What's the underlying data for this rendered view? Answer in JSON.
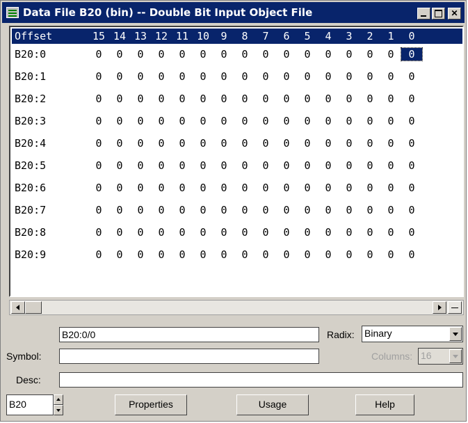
{
  "window": {
    "title": "Data File B20 (bin) -- Double Bit Input Object File"
  },
  "grid": {
    "offset_header": "Offset",
    "bit_headers": [
      "15",
      "14",
      "13",
      "12",
      "11",
      "10",
      "9",
      "8",
      "7",
      "6",
      "5",
      "4",
      "3",
      "2",
      "1",
      "0"
    ],
    "rows": [
      {
        "offset": "B20:0",
        "bits": [
          "0",
          "0",
          "0",
          "0",
          "0",
          "0",
          "0",
          "0",
          "0",
          "0",
          "0",
          "0",
          "0",
          "0",
          "0",
          "0"
        ]
      },
      {
        "offset": "B20:1",
        "bits": [
          "0",
          "0",
          "0",
          "0",
          "0",
          "0",
          "0",
          "0",
          "0",
          "0",
          "0",
          "0",
          "0",
          "0",
          "0",
          "0"
        ]
      },
      {
        "offset": "B20:2",
        "bits": [
          "0",
          "0",
          "0",
          "0",
          "0",
          "0",
          "0",
          "0",
          "0",
          "0",
          "0",
          "0",
          "0",
          "0",
          "0",
          "0"
        ]
      },
      {
        "offset": "B20:3",
        "bits": [
          "0",
          "0",
          "0",
          "0",
          "0",
          "0",
          "0",
          "0",
          "0",
          "0",
          "0",
          "0",
          "0",
          "0",
          "0",
          "0"
        ]
      },
      {
        "offset": "B20:4",
        "bits": [
          "0",
          "0",
          "0",
          "0",
          "0",
          "0",
          "0",
          "0",
          "0",
          "0",
          "0",
          "0",
          "0",
          "0",
          "0",
          "0"
        ]
      },
      {
        "offset": "B20:5",
        "bits": [
          "0",
          "0",
          "0",
          "0",
          "0",
          "0",
          "0",
          "0",
          "0",
          "0",
          "0",
          "0",
          "0",
          "0",
          "0",
          "0"
        ]
      },
      {
        "offset": "B20:6",
        "bits": [
          "0",
          "0",
          "0",
          "0",
          "0",
          "0",
          "0",
          "0",
          "0",
          "0",
          "0",
          "0",
          "0",
          "0",
          "0",
          "0"
        ]
      },
      {
        "offset": "B20:7",
        "bits": [
          "0",
          "0",
          "0",
          "0",
          "0",
          "0",
          "0",
          "0",
          "0",
          "0",
          "0",
          "0",
          "0",
          "0",
          "0",
          "0"
        ]
      },
      {
        "offset": "B20:8",
        "bits": [
          "0",
          "0",
          "0",
          "0",
          "0",
          "0",
          "0",
          "0",
          "0",
          "0",
          "0",
          "0",
          "0",
          "0",
          "0",
          "0"
        ]
      },
      {
        "offset": "B20:9",
        "bits": [
          "0",
          "0",
          "0",
          "0",
          "0",
          "0",
          "0",
          "0",
          "0",
          "0",
          "0",
          "0",
          "0",
          "0",
          "0",
          "0"
        ]
      }
    ]
  },
  "address": {
    "value": "B20:0/0"
  },
  "radix": {
    "label": "Radix:",
    "value": "Binary"
  },
  "symbol": {
    "label": "Symbol:",
    "value": ""
  },
  "columns": {
    "label": "Columns:",
    "value": "16"
  },
  "desc": {
    "label": "Desc:",
    "value": ""
  },
  "file_selector": {
    "value": "B20"
  },
  "buttons": {
    "properties": "Properties",
    "usage": "Usage",
    "help": "Help"
  }
}
